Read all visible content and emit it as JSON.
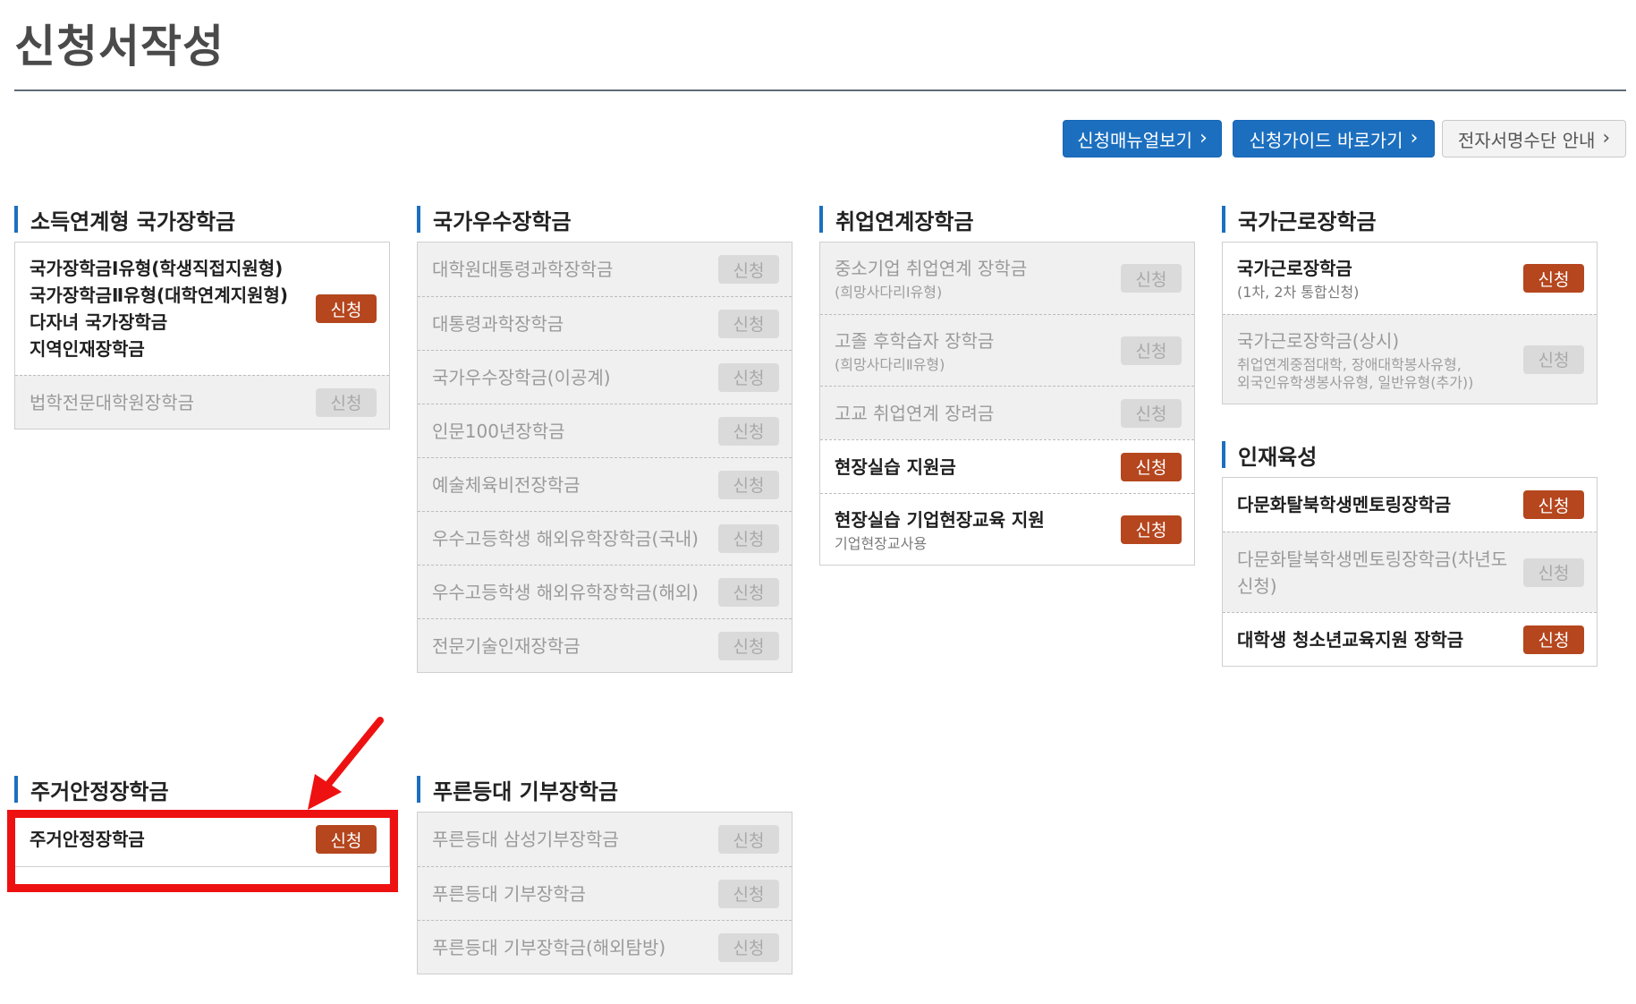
{
  "header": {
    "title": "신청서작성"
  },
  "top_buttons": {
    "manual": "신청매뉴얼보기",
    "guide": "신청가이드 바로가기",
    "esign": "전자서명수단 안내"
  },
  "sections": [
    {
      "title": "소득연계형 국가장학금",
      "rows": [
        {
          "lines": [
            "국가장학금Ⅰ유형(학생직접지원형)",
            "국가장학금Ⅱ유형(대학연계지원형)",
            "다자녀 국가장학금",
            "지역인재장학금"
          ],
          "button": "신청",
          "enabled": true
        },
        {
          "label": "법학전문대학원장학금",
          "button": "신청",
          "enabled": false
        }
      ]
    },
    {
      "title": "국가우수장학금",
      "rows": [
        {
          "label": "대학원대통령과학장학금",
          "button": "신청",
          "enabled": false
        },
        {
          "label": "대통령과학장학금",
          "button": "신청",
          "enabled": false
        },
        {
          "label": "국가우수장학금(이공계)",
          "button": "신청",
          "enabled": false
        },
        {
          "label": "인문100년장학금",
          "button": "신청",
          "enabled": false
        },
        {
          "label": "예술체육비전장학금",
          "button": "신청",
          "enabled": false
        },
        {
          "label": "우수고등학생 해외유학장학금(국내)",
          "button": "신청",
          "enabled": false
        },
        {
          "label": "우수고등학생 해외유학장학금(해외)",
          "button": "신청",
          "enabled": false
        },
        {
          "label": "전문기술인재장학금",
          "button": "신청",
          "enabled": false
        }
      ]
    },
    {
      "title": "취업연계장학금",
      "rows": [
        {
          "label": "중소기업 취업연계 장학금",
          "sub": "(희망사다리Ⅰ유형)",
          "button": "신청",
          "enabled": false
        },
        {
          "label": "고졸 후학습자 장학금",
          "sub": "(희망사다리Ⅱ유형)",
          "button": "신청",
          "enabled": false
        },
        {
          "label": "고교 취업연계 장려금",
          "button": "신청",
          "enabled": false
        },
        {
          "label": "현장실습 지원금",
          "button": "신청",
          "enabled": true
        },
        {
          "label": "현장실습 기업현장교육 지원",
          "sub": "기업현장교사용",
          "button": "신청",
          "enabled": true
        }
      ]
    },
    {
      "title": "국가근로장학금",
      "rows": [
        {
          "label": "국가근로장학금",
          "sub": "(1차, 2차 통합신청)",
          "button": "신청",
          "enabled": true
        },
        {
          "label": "국가근로장학금(상시)",
          "sub_lines": [
            "취업연계중점대학, 장애대학봉사유형,",
            "외국인유학생봉사유형, 일반유형(추가))"
          ],
          "button": "신청",
          "enabled": false
        }
      ]
    },
    {
      "title": "인재육성",
      "rows": [
        {
          "label": "다문화탈북학생멘토링장학금",
          "button": "신청",
          "enabled": true
        },
        {
          "lines": [
            "다문화탈북학생멘토링장학금(차년도",
            "신청)"
          ],
          "button": "신청",
          "enabled": false
        },
        {
          "label": "대학생 청소년교육지원 장학금",
          "button": "신청",
          "enabled": true
        }
      ]
    },
    {
      "title": "주거안정장학금",
      "rows": [
        {
          "label": "주거안정장학금",
          "button": "신청",
          "enabled": true
        }
      ]
    },
    {
      "title": "푸른등대 기부장학금",
      "rows": [
        {
          "label": "푸른등대 삼성기부장학금",
          "button": "신청",
          "enabled": false
        },
        {
          "label": "푸른등대 기부장학금",
          "button": "신청",
          "enabled": false
        },
        {
          "label": "푸른등대 기부장학금(해외탐방)",
          "button": "신청",
          "enabled": false
        }
      ]
    }
  ],
  "colors": {
    "accent_blue": "#1c6fbf",
    "apply_active": "#b5461e",
    "apply_inactive": "#dadada",
    "highlight_red": "#ee1111"
  }
}
